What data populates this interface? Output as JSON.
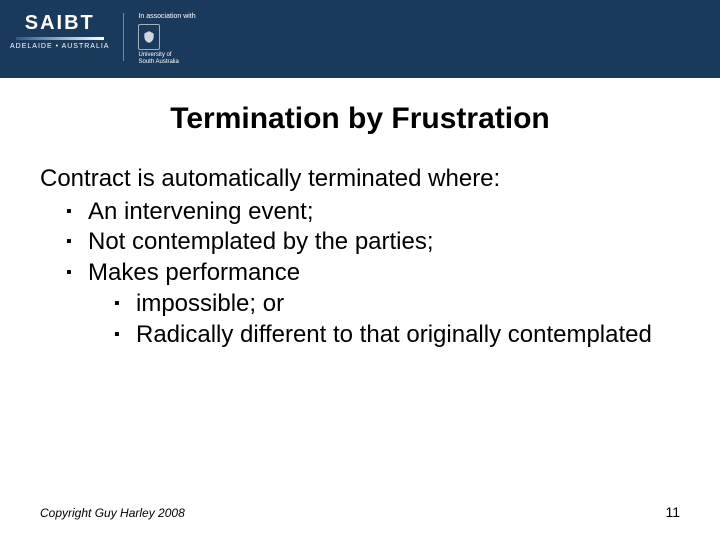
{
  "header": {
    "logo_primary": "SAIBT",
    "logo_primary_sub": "ADELAIDE • AUSTRALIA",
    "assoc_top": "In association with",
    "assoc_uni_line1": "University of",
    "assoc_uni_line2": "South Australia"
  },
  "slide": {
    "title": "Termination by Frustration",
    "intro": "Contract is automatically terminated where:",
    "bullets_lvl1": [
      "An intervening event;",
      "Not contemplated by the parties;",
      "Makes performance"
    ],
    "bullets_lvl2": [
      "impossible; or",
      "Radically different to that originally contemplated"
    ]
  },
  "footer": {
    "copyright": "Copyright Guy Harley 2008",
    "page": "11"
  }
}
